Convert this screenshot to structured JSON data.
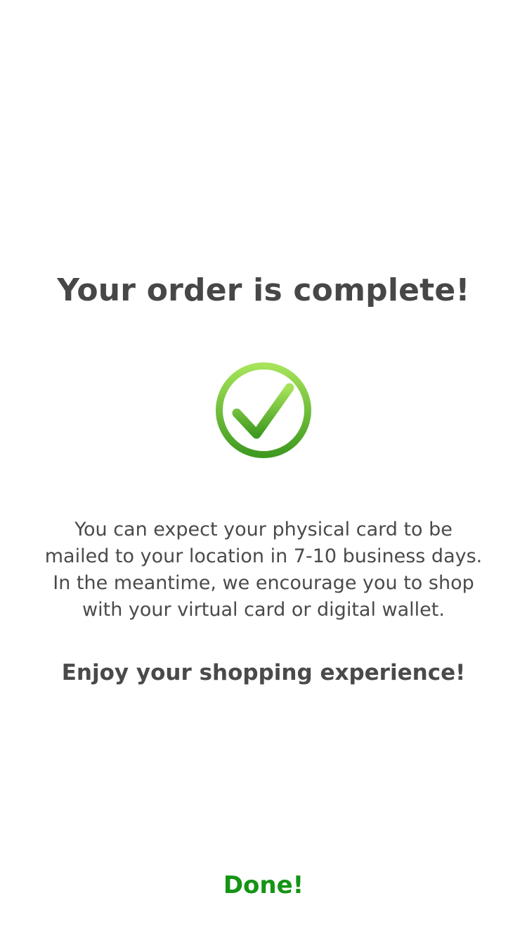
{
  "title": "Your order is complete!",
  "success_icon": "checkmark-circle-icon",
  "message_lines": [
    "You can expect your physical card to be",
    "mailed to your location in 7-10 business days.",
    "In the meantime, we encourage you to shop",
    "with your virtual card or digital wallet."
  ],
  "closing": "Enjoy your shopping experience!",
  "done_label": "Done!",
  "colors": {
    "accent_green": "#159415",
    "icon_green_top": "#a6e35a",
    "icon_green_bottom": "#3f9a20",
    "text": "#474747"
  }
}
